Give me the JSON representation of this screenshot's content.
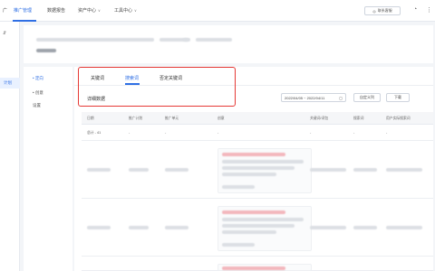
{
  "topbar": {
    "nav": [
      {
        "label": "广"
      },
      {
        "label": "推广管理"
      },
      {
        "label": "数据报告"
      },
      {
        "label": "资产中心"
      },
      {
        "label": "工具中心"
      }
    ],
    "right_button_label": "联系客服"
  },
  "left_rail": {
    "active_label": "计划"
  },
  "subnav": {
    "items": [
      {
        "label": "• 定向"
      },
      {
        "label": "• 创意"
      },
      {
        "label": "设置"
      }
    ]
  },
  "content": {
    "tabs": [
      {
        "label": "关键词"
      },
      {
        "label": "搜索词"
      },
      {
        "label": "否定关键词"
      }
    ],
    "section_title": "详细数据",
    "date_range": "2022/04/05 ~ 2022/04/11",
    "btn_columns": "自定义列",
    "btn_download": "下载",
    "table": {
      "headers": [
        "日期",
        "推广计划",
        "推广单元",
        "创意",
        "关键词/词包",
        "搜索词",
        "用户实际搜索词"
      ],
      "summary_label": "总计 - 41",
      "summary_dash": "-"
    }
  },
  "colors": {
    "accent": "#2f6fe4",
    "highlight_box": "#e53935"
  }
}
